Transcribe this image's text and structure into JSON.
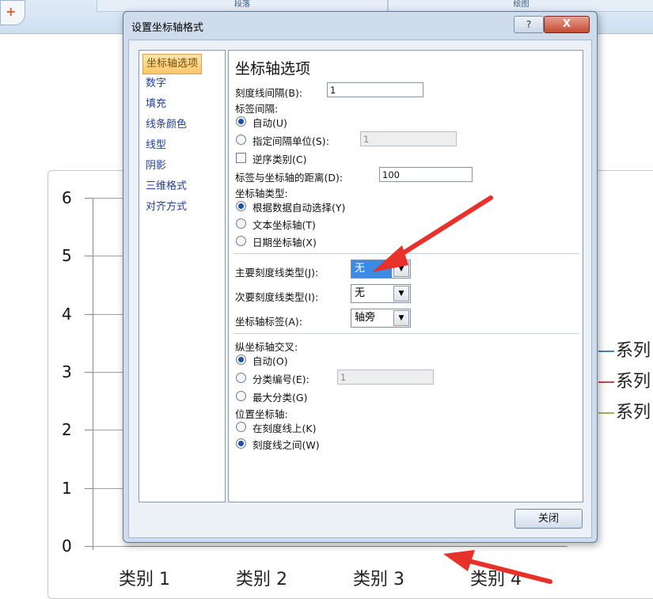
{
  "ribbon": {
    "group_left": "段落",
    "group_right": "绘图"
  },
  "dialog": {
    "title": "设置坐标轴格式",
    "help_label": "?",
    "close_label": "X",
    "nav": [
      "坐标轴选项",
      "数字",
      "填充",
      "线条颜色",
      "线型",
      "阴影",
      "三维格式",
      "对齐方式"
    ],
    "panel_title": "坐标轴选项",
    "tick_interval_label": "刻度线间隔(B):",
    "tick_interval_value": "1",
    "label_interval_label": "标签间隔:",
    "auto_label": "自动(U)",
    "specify_interval_label": "指定间隔单位(S):",
    "specify_interval_value": "1",
    "reverse_label": "逆序类别(C)",
    "distance_label": "标签与坐标轴的距离(D):",
    "distance_value": "100",
    "axis_type_label": "坐标轴类型:",
    "axis_type_auto": "根据数据自动选择(Y)",
    "axis_type_text": "文本坐标轴(T)",
    "axis_type_date": "日期坐标轴(X)",
    "major_tick_label": "主要刻度线类型(J):",
    "major_tick_value": "无",
    "minor_tick_label": "次要刻度线类型(I):",
    "minor_tick_value": "无",
    "axis_labels_label": "坐标轴标签(A):",
    "axis_labels_value": "轴旁",
    "cross_label": "纵坐标轴交叉:",
    "cross_auto": "自动(O)",
    "cross_category_label": "分类编号(E):",
    "cross_category_value": "1",
    "cross_max": "最大分类(G)",
    "position_label": "位置坐标轴:",
    "position_on": "在刻度线上(K)",
    "position_between": "刻度线之间(W)",
    "close_button": "关闭"
  },
  "chart_data": {
    "type": "line",
    "y_ticks": [
      "0",
      "1",
      "2",
      "3",
      "4",
      "5",
      "6"
    ],
    "categories": [
      "类别 1",
      "类别 2",
      "类别 3",
      "类别 4"
    ],
    "legend": [
      {
        "name": "系列",
        "color": "#4a7ebb"
      },
      {
        "name": "系列",
        "color": "#be4b48"
      },
      {
        "name": "系列",
        "color": "#98b954"
      }
    ],
    "ylim": [
      0,
      6
    ]
  },
  "colors": {
    "arrow": "#e8312a",
    "selection": "#3a8ae6"
  }
}
